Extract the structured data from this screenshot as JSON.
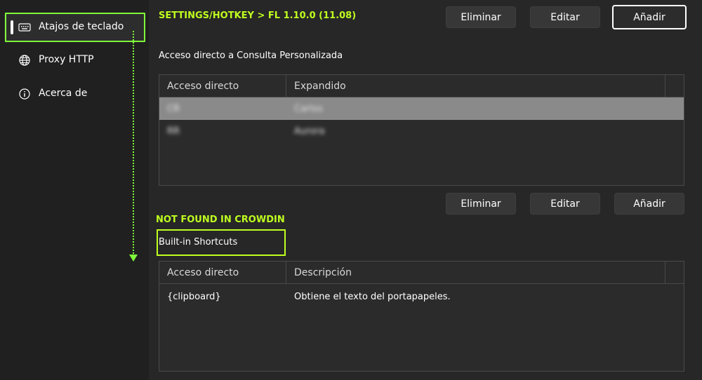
{
  "sidebar": {
    "items": [
      {
        "label": "Atajos de teclado",
        "icon": "keyboard-icon",
        "active": true
      },
      {
        "label": "Proxy HTTP",
        "icon": "globe-icon",
        "active": false
      },
      {
        "label": "Acerca de",
        "icon": "info-icon",
        "active": false
      }
    ]
  },
  "annotations": {
    "title": "SETTINGS/HOTKEY > FL 1.10.0 (11.08)",
    "not_found": "NOT FOUND IN CROWDIN",
    "accent": "#bfff1f"
  },
  "top_buttons": {
    "delete": "Eliminar",
    "edit": "Editar",
    "add": "Añadir"
  },
  "custom_query": {
    "title": "Acceso directo a Consulta Personalizada",
    "columns": [
      "Acceso directo",
      "Expandido"
    ],
    "rows": [
      {
        "shortcut": "CR",
        "expanded": "Carlos"
      },
      {
        "shortcut": "RR",
        "expanded": "Aurora"
      }
    ]
  },
  "middle_buttons": {
    "delete": "Eliminar",
    "edit": "Editar",
    "add": "Añadir"
  },
  "builtin": {
    "title": "Built-in Shortcuts",
    "columns": [
      "Acceso directo",
      "Descripción"
    ],
    "rows": [
      {
        "shortcut": "{clipboard}",
        "description": "Obtiene el texto del portapapeles."
      }
    ]
  }
}
